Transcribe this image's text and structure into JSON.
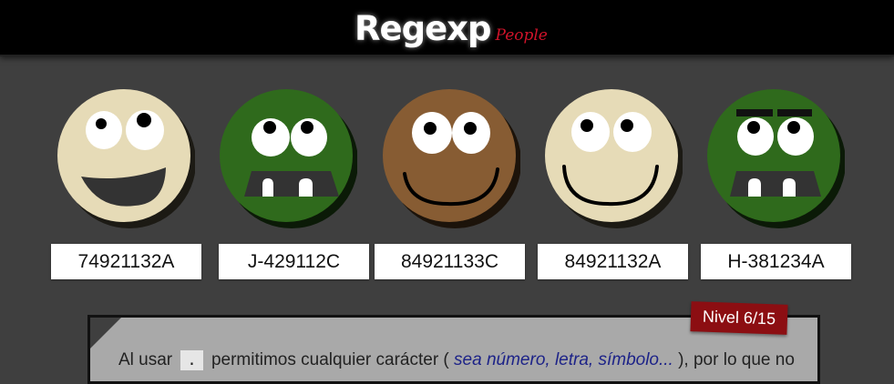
{
  "header": {
    "logo_main": "Regexp",
    "logo_sub": "People"
  },
  "faces": [
    {
      "label": "74921132A",
      "skin": "#e6dbb7",
      "type": "open-smile"
    },
    {
      "label": "J-429112C",
      "skin": "#2f6a1c",
      "type": "teeth"
    },
    {
      "label": "84921133C",
      "skin": "#875c33",
      "type": "smile"
    },
    {
      "label": "84921132A",
      "skin": "#e6dbb7",
      "type": "smile"
    },
    {
      "label": "H-381234A",
      "skin": "#2f6a1c",
      "type": "teeth-brows"
    }
  ],
  "level": {
    "label": "Nivel",
    "current": "6",
    "separator": " / ",
    "total": "15"
  },
  "instructions": {
    "part1": "Al usar",
    "code": ".",
    "part2": "permitimos cualquier carácter (",
    "highlight": "sea número, letra, símbolo...",
    "part3": "), por lo que no"
  }
}
